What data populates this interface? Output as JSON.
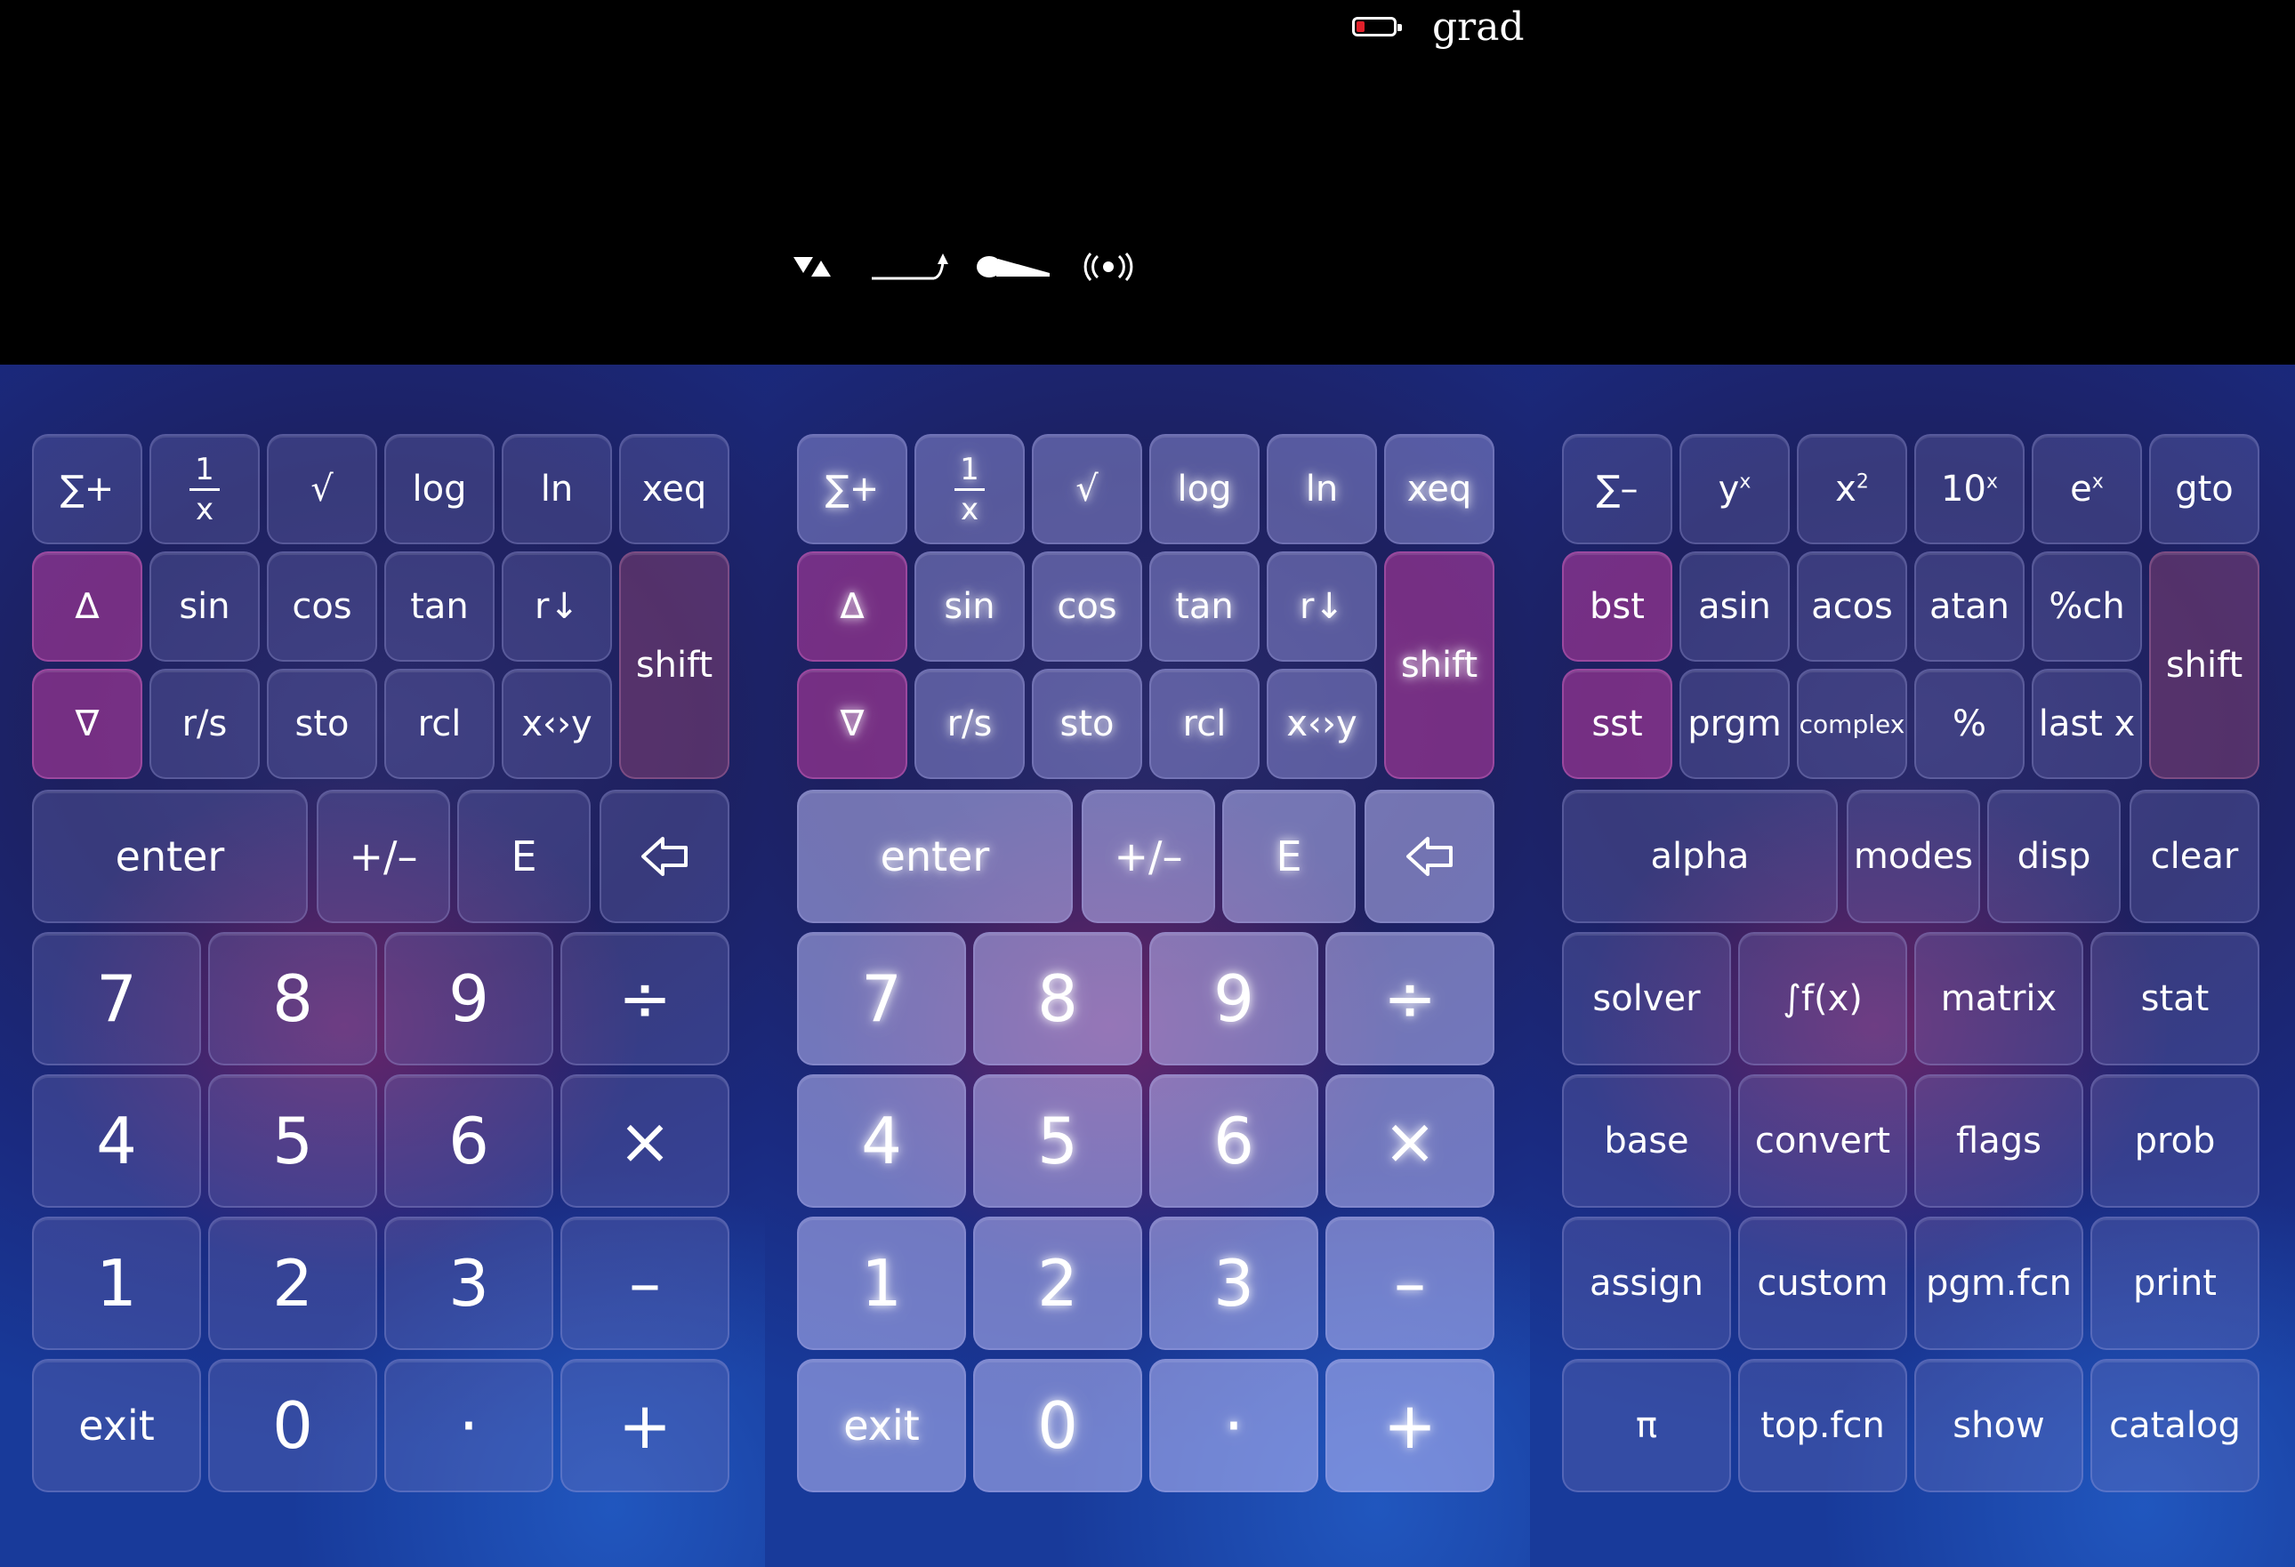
{
  "status_bar": {
    "angle_mode": "grad",
    "icons": [
      "battery-low-icon"
    ]
  },
  "annunciators": [
    "shift-arrows-annunciator",
    "print-arrow-annunciator",
    "printer-icon",
    "busy-signal-icon"
  ],
  "keyboard_primary": {
    "row1": [
      "∑+",
      "1/x",
      "√",
      "log",
      "ln",
      "xeq"
    ],
    "row2": [
      "∆",
      "sin",
      "cos",
      "tan",
      "r↓"
    ],
    "row3": [
      "∇",
      "r/s",
      "sto",
      "rcl",
      "x‹›y"
    ],
    "shift": "shift",
    "row4": [
      "enter",
      "+/–",
      "E",
      "backspace"
    ],
    "digits": [
      [
        "7",
        "8",
        "9",
        "÷"
      ],
      [
        "4",
        "5",
        "6",
        "×"
      ],
      [
        "1",
        "2",
        "3",
        "–"
      ],
      [
        "exit",
        "0",
        "·",
        "+"
      ]
    ]
  },
  "keyboard_shifted": {
    "row1": [
      "∑–",
      "y",
      "x",
      "10",
      "e",
      "gto"
    ],
    "row1_sup": [
      "",
      "x",
      "2",
      "x",
      "x",
      ""
    ],
    "row2": [
      "bst",
      "asin",
      "acos",
      "atan",
      "%ch"
    ],
    "row3": [
      "sst",
      "prgm",
      "complex",
      "%",
      "last x"
    ],
    "shift": "shift",
    "row4": [
      "alpha",
      "modes",
      "disp",
      "clear"
    ],
    "menus": [
      [
        "solver",
        "∫f(x)",
        "matrix",
        "stat"
      ],
      [
        "base",
        "convert",
        "flags",
        "prob"
      ],
      [
        "assign",
        "custom",
        "pgm.fcn",
        "print"
      ],
      [
        "π",
        "top.fcn",
        "show",
        "catalog"
      ]
    ]
  },
  "frac": {
    "num": "1",
    "den": "x"
  },
  "colors": {
    "accent_pink": "#be3ca0",
    "background": "#000000",
    "battery_low": "#e0202a"
  }
}
